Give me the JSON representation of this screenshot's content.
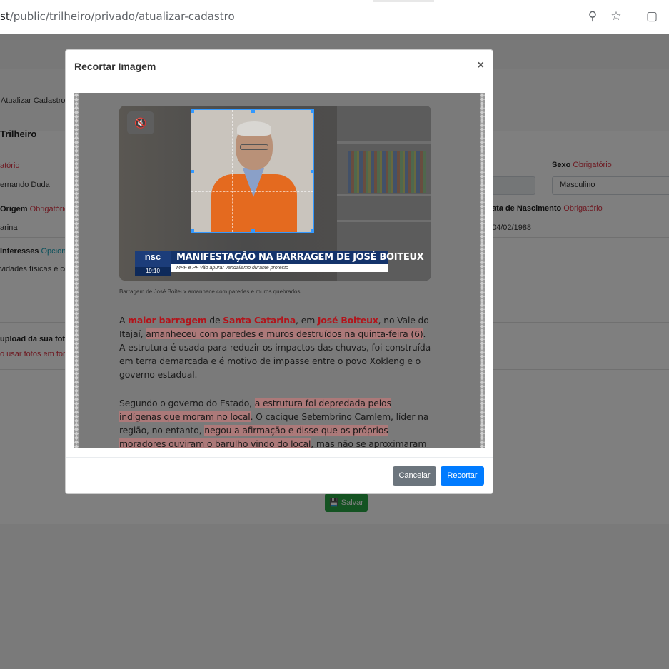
{
  "browser": {
    "url_prefix": "st",
    "url_path": "/public/trilheiro/privado/atualizar-cadastro"
  },
  "page": {
    "breadcrumb": "Atualizar Cadastro",
    "card_title": "Trilheiro",
    "fields": {
      "name_label_req": "atório",
      "name_value": "ernando Duda",
      "sex_label": "Sexo",
      "sex_req": "Obrigatório",
      "sex_value": "Masculino",
      "origin_label": "Origem",
      "origin_req": "Obrigatório",
      "origin_value": "arina",
      "birth_label": "ata de Nascimento",
      "birth_req": "Obrigatório",
      "birth_value": "04/02/1988",
      "interests_label": "Interesses",
      "interests_opt": "Opciona",
      "interests_value": "vidades físicas e con",
      "upload_label": "upload da sua foto",
      "upload_hint": "o usar fotos em form"
    },
    "save_button": "Salvar"
  },
  "modal": {
    "title": "Recortar Imagem",
    "close": "×",
    "image": {
      "mute_icon": "🔇",
      "logo": "nsc",
      "time": "19:10",
      "headline": "MANIFESTAÇÃO NA BARRAGEM DE JOSÉ BOITEUX",
      "subheadline": "MPF e PF vão apurar vandalismo durante protesto",
      "caption": "Barragem de José Boiteux amanhece com paredes e muros quebrados",
      "p1": {
        "a": "A ",
        "kw1": "maior barragem",
        "b": " de ",
        "kw2": "Santa Catarina",
        "c": ", em ",
        "kw3": "José Boiteux",
        "d": ", no Vale do Itajaí, ",
        "hl": "amanheceu com paredes e muros destruídos na quinta-feira (6)",
        "e": ". A estrutura é usada para reduzir os impactos das chuvas, foi construída em terra demarcada e é motivo de impasse entre o povo Xokleng e o governo estadual."
      },
      "p2": {
        "a": "Segundo o governo do Estado, ",
        "hl1": "a estrutura foi depredada pelos indígenas que moram no local",
        "b": ". O cacique Setembrino Camlem, líder na região, no entanto, ",
        "hl2": "negou a afirmação e disse que os próprios moradores ouviram o barulho vindo do local",
        "c": ", mas não se aproximaram por medo."
      }
    },
    "cancel": "Cancelar",
    "crop": "Recortar"
  }
}
